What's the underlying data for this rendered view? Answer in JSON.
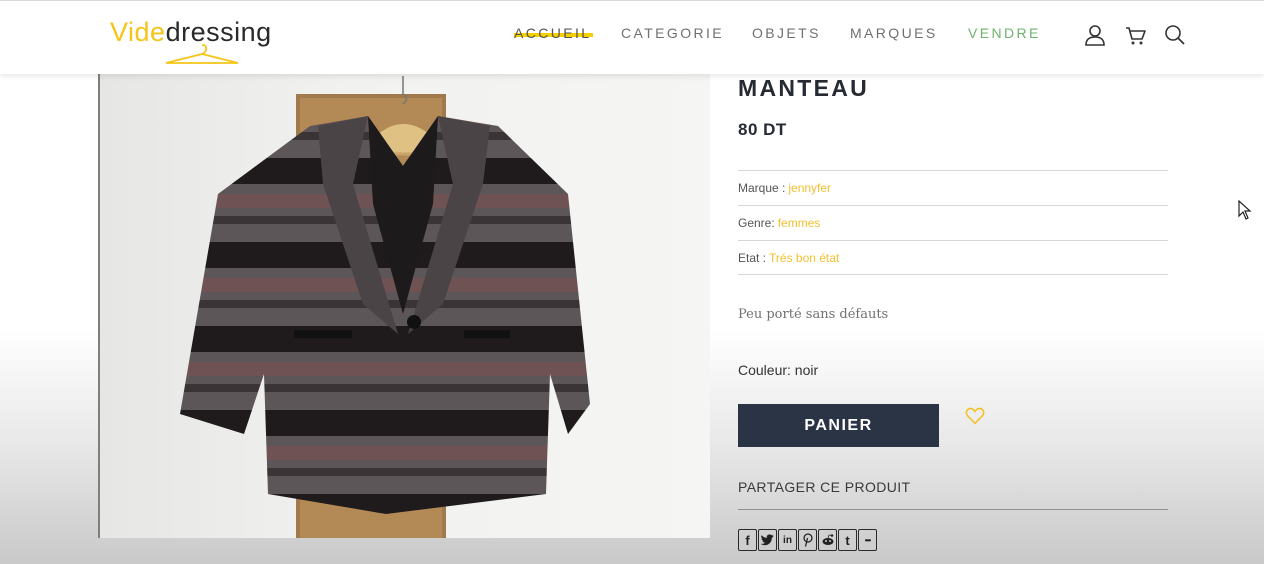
{
  "header": {
    "logo_part1": "Vide",
    "logo_part2": "dressing",
    "nav": [
      {
        "label": "ACCUEIL"
      },
      {
        "label": "CATEGORIE"
      },
      {
        "label": "OBJETS"
      },
      {
        "label": "MARQUES"
      },
      {
        "label": "VENDRE"
      }
    ],
    "icons": [
      "user-icon",
      "cart-icon",
      "search-icon"
    ]
  },
  "product": {
    "title": "MANTEAU",
    "price": "80 DT",
    "attributes": [
      {
        "label": "Marque :",
        "value": "jennyfer"
      },
      {
        "label": "Genre:",
        "value": "femmes"
      },
      {
        "label": "Etat :",
        "value": "Trés bon état"
      }
    ],
    "description": "Peu porté sans défauts",
    "color_line": "Couleur: noir",
    "cart_button": "PANIER",
    "share_label": "PARTAGER CE PRODUIT",
    "share_buttons": [
      {
        "icon": "facebook-icon",
        "glyph": "f"
      },
      {
        "icon": "twitter-icon",
        "glyph": "🐦"
      },
      {
        "icon": "linkedin-icon",
        "glyph": "in"
      },
      {
        "icon": "pinterest-icon",
        "glyph": "℗"
      },
      {
        "icon": "reddit-icon",
        "glyph": "◉"
      },
      {
        "icon": "tumblr-icon",
        "glyph": "t"
      },
      {
        "icon": "more-icon",
        "glyph": "•••"
      }
    ]
  },
  "colors": {
    "accent": "#f5c518",
    "button": "#2b3445",
    "sell": "#6db36d",
    "attribute_value": "#f2c12e"
  }
}
